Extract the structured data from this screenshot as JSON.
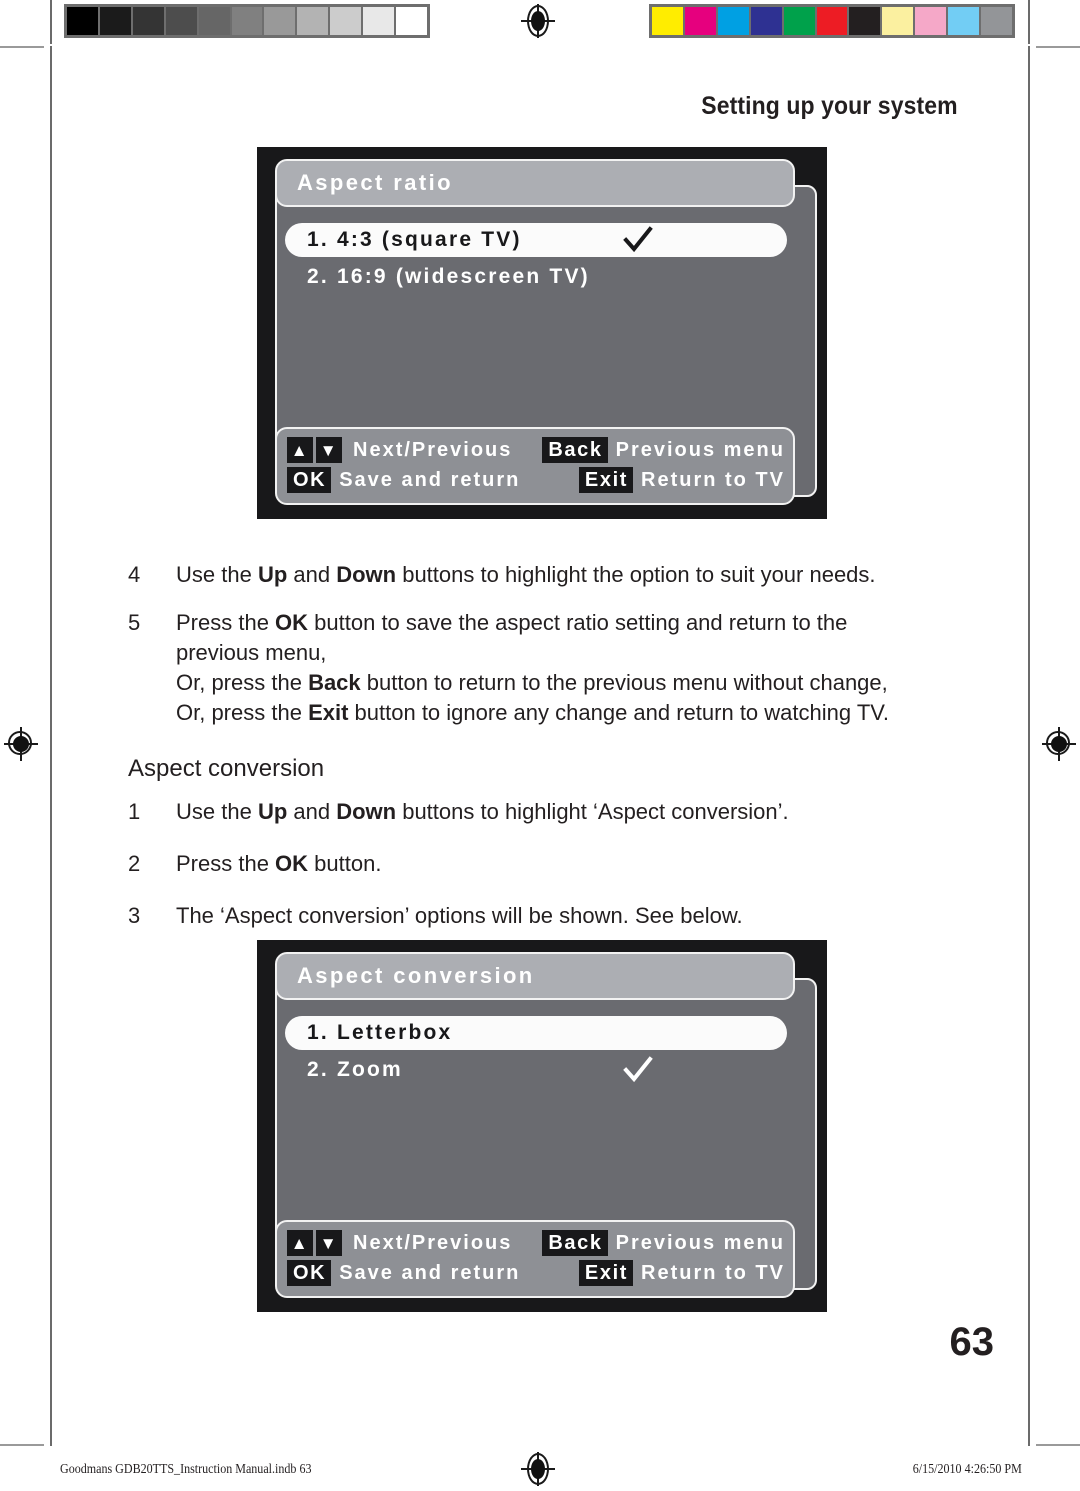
{
  "page": {
    "header_title": "Setting up your system",
    "page_number": "63",
    "section_heading": "Aspect conversion"
  },
  "calibration": {
    "grayscale_label": "grayscale-calibration-bar",
    "grayscale_swatches": [
      "#000000",
      "#1b1b1b",
      "#343434",
      "#4d4d4d",
      "#666666",
      "#808080",
      "#999999",
      "#b3b3b3",
      "#cccccc",
      "#e8e8e8",
      "#ffffff"
    ],
    "color_label": "color-calibration-bar",
    "color_swatches": [
      "#ffed00",
      "#e6007e",
      "#00a0e3",
      "#2e3192",
      "#00a14b",
      "#ed1c24",
      "#231f20",
      "#fbf0a0",
      "#f5a8c8",
      "#72cdf4",
      "#939598"
    ]
  },
  "osd_aspect_ratio": {
    "title": "Aspect ratio",
    "items": [
      {
        "label": "1. 4:3 (square TV)",
        "selected": true,
        "checked": true
      },
      {
        "label": "2. 16:9 (widescreen TV)",
        "selected": false,
        "checked": false
      }
    ],
    "footer": {
      "up_key": "▲",
      "down_key": "▼",
      "nav_label": "Next/Previous",
      "back_key": "Back",
      "back_label": "Previous menu",
      "ok_key": "OK",
      "ok_label": "Save and return",
      "exit_key": "Exit",
      "exit_label": "Return to TV"
    }
  },
  "osd_aspect_conversion": {
    "title": "Aspect conversion",
    "items": [
      {
        "label": "1. Letterbox",
        "selected": true,
        "checked": false
      },
      {
        "label": "2. Zoom",
        "selected": false,
        "checked": true
      }
    ],
    "footer": {
      "up_key": "▲",
      "down_key": "▼",
      "nav_label": "Next/Previous",
      "back_key": "Back",
      "back_label": "Previous menu",
      "ok_key": "OK",
      "ok_label": "Save and return",
      "exit_key": "Exit",
      "exit_label": "Return to TV"
    }
  },
  "steps_aspect_ratio": [
    {
      "num": "4",
      "html": "Use the <b>Up</b> and <b>Down</b> buttons to highlight the option to suit your needs."
    },
    {
      "num": "5",
      "html": "Press the <b>OK</b> button to save the aspect ratio setting and return to the previous menu,<br>Or, press the <b>Back</b> button to return to the previous menu without change,<br>Or, press the <b>Exit</b> button to ignore any change and return to watching TV."
    }
  ],
  "steps_aspect_conversion": [
    {
      "num": "1",
      "html": "Use the <b>Up</b> and <b>Down</b> buttons to highlight ‘Aspect conversion’."
    },
    {
      "num": "2",
      "html": "Press the <b>OK</b> button."
    },
    {
      "num": "3",
      "html": "The ‘Aspect conversion’ options will be shown. See below."
    }
  ],
  "footer_slug": {
    "left": "Goodmans GDB20TTS_Instruction Manual.indb   63",
    "right": "6/15/2010   4:26:50 PM"
  }
}
